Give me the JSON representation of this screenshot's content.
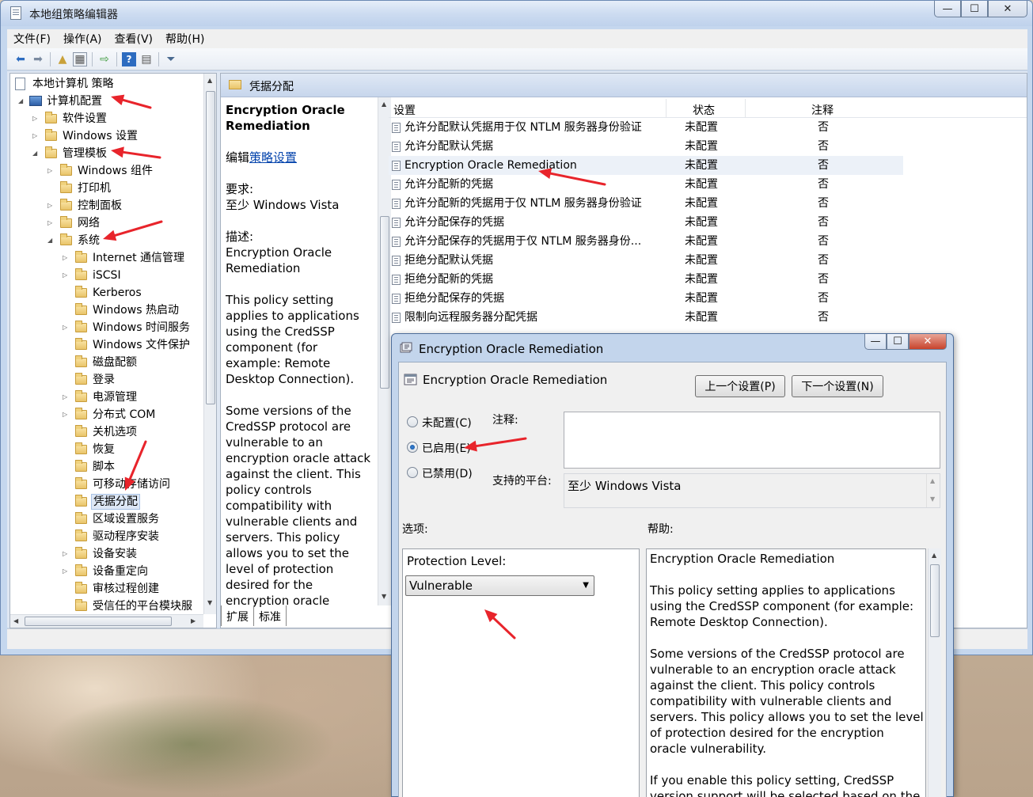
{
  "window": {
    "title": "本地组策略编辑器",
    "caption": {
      "minimize": "—",
      "maximize": "☐",
      "close": "✕"
    }
  },
  "menu": [
    "文件(F)",
    "操作(A)",
    "查看(V)",
    "帮助(H)"
  ],
  "tree": {
    "root": "本地计算机 策略",
    "computer_config": "计算机配置",
    "software_settings": "软件设置",
    "windows_settings": "Windows 设置",
    "admin_templates": "管理模板",
    "windows_components": "Windows 组件",
    "printers": "打印机",
    "control_panel": "控制面板",
    "network": "网络",
    "system": "系统",
    "system_children": [
      "Internet 通信管理",
      "iSCSI",
      "Kerberos",
      "Windows 热启动",
      "Windows 时间服务",
      "Windows 文件保护",
      "磁盘配额",
      "登录",
      "电源管理",
      "分布式 COM",
      "关机选项",
      "恢复",
      "脚本",
      "可移动存储访问",
      "凭据分配",
      "区域设置服务",
      "驱动程序安装",
      "设备安装",
      "设备重定向",
      "审核过程创建",
      "受信任的平台模块服"
    ]
  },
  "section": {
    "title": "凭据分配",
    "desc_title": "Encryption Oracle Remediation",
    "edit_prefix": "编辑",
    "edit_link": "策略设置",
    "req_label": "要求:",
    "req_value": "至少 Windows Vista",
    "desc_label": "描述:",
    "desc_name": "Encryption Oracle Remediation",
    "desc_p1": "This policy setting applies to applications using the CredSSP component (for example: Remote Desktop Connection).",
    "desc_p2": "Some versions of the CredSSP protocol are vulnerable to an encryption oracle attack against the client.  This policy controls compatibility with vulnerable clients and servers.  This policy allows you to set the level of protection desired for the encryption oracle",
    "tabs": [
      "扩展",
      "标准"
    ]
  },
  "list": {
    "headers": {
      "setting": "设置",
      "state": "状态",
      "note": "注释"
    },
    "rows": [
      {
        "setting": "允许分配默认凭据用于仅 NTLM 服务器身份验证",
        "state": "未配置",
        "note": "否"
      },
      {
        "setting": "允许分配默认凭据",
        "state": "未配置",
        "note": "否"
      },
      {
        "setting": "Encryption Oracle Remediation",
        "state": "未配置",
        "note": "否"
      },
      {
        "setting": "允许分配新的凭据",
        "state": "未配置",
        "note": "否"
      },
      {
        "setting": "允许分配新的凭据用于仅 NTLM 服务器身份验证",
        "state": "未配置",
        "note": "否"
      },
      {
        "setting": "允许分配保存的凭据",
        "state": "未配置",
        "note": "否"
      },
      {
        "setting": "允许分配保存的凭据用于仅 NTLM 服务器身份...",
        "state": "未配置",
        "note": "否"
      },
      {
        "setting": "拒绝分配默认凭据",
        "state": "未配置",
        "note": "否"
      },
      {
        "setting": "拒绝分配新的凭据",
        "state": "未配置",
        "note": "否"
      },
      {
        "setting": "拒绝分配保存的凭据",
        "state": "未配置",
        "note": "否"
      },
      {
        "setting": "限制向远程服务器分配凭据",
        "state": "未配置",
        "note": "否"
      }
    ]
  },
  "dialog": {
    "title": "Encryption Oracle Remediation",
    "setting_name": "Encryption Oracle Remediation",
    "prev_button": "上一个设置(P)",
    "next_button": "下一个设置(N)",
    "radio_not_configured": "未配置(C)",
    "radio_enabled": "已启用(E)",
    "radio_disabled": "已禁用(D)",
    "selected_radio": "enabled",
    "comment_label": "注释:",
    "comment_value": "",
    "platform_label": "支持的平台:",
    "platform_value": "至少 Windows Vista",
    "options_label": "选项:",
    "help_label": "帮助:",
    "protection_label": "Protection Level:",
    "protection_value": "Vulnerable",
    "help_title": "Encryption Oracle Remediation",
    "help_p1": "This policy setting applies to applications using the CredSSP component (for example: Remote Desktop Connection).",
    "help_p2": "Some versions of the CredSSP protocol are vulnerable to an encryption oracle attack against the client.  This policy controls compatibility with vulnerable clients and servers.  This policy allows you to set the level of protection desired for the encryption oracle vulnerability.",
    "help_p3": "If you enable this policy setting, CredSSP version support will be selected based on the"
  },
  "colors": {
    "annotation_arrow": "#e8242b",
    "selection": "#dde7f5",
    "title_bar": "#c5d7ee"
  }
}
